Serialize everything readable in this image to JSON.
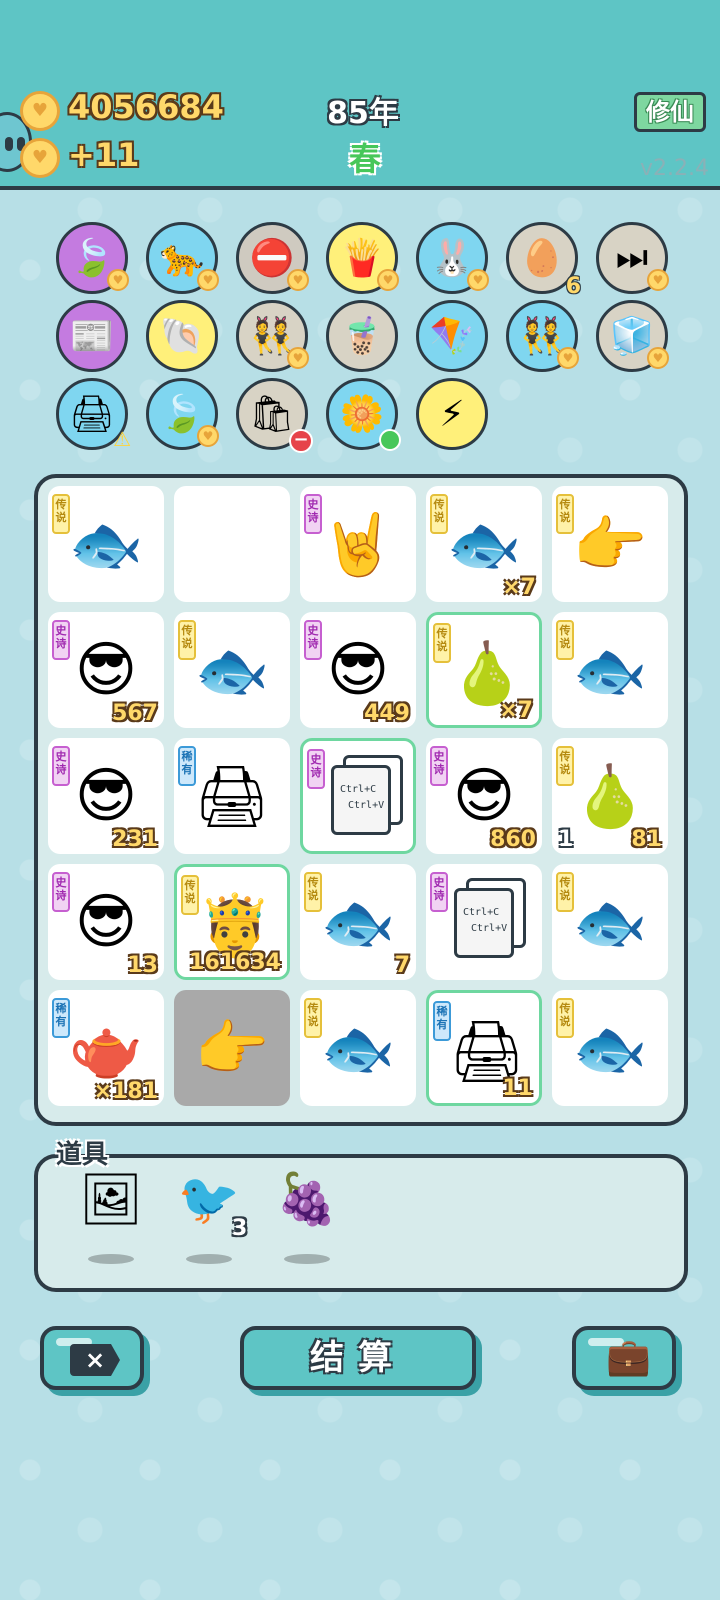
{
  "header": {
    "gold": "4056684",
    "gold_income": "+11",
    "year": "85年",
    "season": "春",
    "cultivate_button": "修仙",
    "version": "v2.2.4"
  },
  "relics": [
    {
      "icon": "🍃",
      "bg": "#c47be0",
      "badge": "heart"
    },
    {
      "icon": "🐆",
      "bg": "#7fd6f0",
      "badge": "heart"
    },
    {
      "icon": "⛔",
      "bg": "#cfcac0",
      "badge": "heart"
    },
    {
      "icon": "🍟",
      "bg": "#fff07a",
      "badge": "heart"
    },
    {
      "icon": "🐰",
      "bg": "#7fd6f0",
      "badge": "heart"
    },
    {
      "icon": "🥚",
      "bg": "#d8d3c5",
      "count": "6"
    },
    {
      "icon": "⏭",
      "bg": "#d8d3c5",
      "badge": "heart"
    },
    {
      "icon": "📰",
      "bg": "#c47be0",
      "badge": ""
    },
    {
      "icon": "🐚",
      "bg": "#fff07a",
      "badge": ""
    },
    {
      "icon": "👯",
      "bg": "#d8d3c5",
      "badge": "heart"
    },
    {
      "icon": "🧋",
      "bg": "#d8d3c5",
      "badge": ""
    },
    {
      "icon": "🪁",
      "bg": "#7fd6f0",
      "badge": ""
    },
    {
      "icon": "👯",
      "bg": "#7fd6f0",
      "badge": "heart"
    },
    {
      "icon": "🧊",
      "bg": "#d8d3c5",
      "badge": "heart"
    },
    {
      "icon": "🖨",
      "bg": "#7fd6f0",
      "badge": "warn"
    },
    {
      "icon": "🍃",
      "bg": "#7fd6f0",
      "badge": "heart"
    },
    {
      "icon": "🛍",
      "bg": "#d8d3c5",
      "badge": "minus"
    },
    {
      "icon": "🌼",
      "bg": "#7fd6f0",
      "badge": "dot"
    },
    {
      "icon": "⚡",
      "bg": "#fff07a",
      "badge": ""
    }
  ],
  "tags": {
    "legend": "传说",
    "epic": "史诗",
    "rare": "稀有"
  },
  "board": [
    {
      "tag": "legend",
      "icon": "🐟",
      "count": ""
    },
    {
      "tag": "",
      "icon": "",
      "count": ""
    },
    {
      "tag": "epic",
      "icon": "🤘",
      "count": ""
    },
    {
      "tag": "legend",
      "icon": "🐟",
      "count": "×7"
    },
    {
      "tag": "legend",
      "icon": "👉",
      "count": ""
    },
    {
      "tag": "epic",
      "icon": "😎",
      "count": "567"
    },
    {
      "tag": "legend",
      "icon": "🐟",
      "count": ""
    },
    {
      "tag": "epic",
      "icon": "😎",
      "count": "449"
    },
    {
      "tag": "legend",
      "icon": "🍐",
      "count": "×7",
      "hl": true
    },
    {
      "tag": "legend",
      "icon": "🐟",
      "count": ""
    },
    {
      "tag": "epic",
      "icon": "😎",
      "count": "231"
    },
    {
      "tag": "rare",
      "icon": "🖨",
      "count": ""
    },
    {
      "tag": "epic",
      "icon": "ctrl",
      "count": "",
      "hl": true
    },
    {
      "tag": "epic",
      "icon": "😎",
      "count": "860"
    },
    {
      "tag": "legend",
      "icon": "🍐",
      "count": "81",
      "left": "1"
    },
    {
      "tag": "epic",
      "icon": "😎",
      "count": "13"
    },
    {
      "tag": "legend",
      "icon": "🤴",
      "count": "161634",
      "hl": true
    },
    {
      "tag": "legend",
      "icon": "🐟",
      "count": "7"
    },
    {
      "tag": "epic",
      "icon": "ctrl",
      "count": ""
    },
    {
      "tag": "legend",
      "icon": "🐟",
      "count": ""
    },
    {
      "tag": "rare",
      "icon": "🫖",
      "count": "×181"
    },
    {
      "tag": "",
      "icon": "👉",
      "count": "",
      "gray": true
    },
    {
      "tag": "legend",
      "icon": "🐟",
      "count": ""
    },
    {
      "tag": "rare",
      "icon": "🖨",
      "count": "11",
      "hl": true
    },
    {
      "tag": "legend",
      "icon": "🐟",
      "count": ""
    }
  ],
  "ctrl_text": {
    "line1": "Ctrl+C",
    "line2": "Ctrl+V"
  },
  "items_label": "道具",
  "items": [
    {
      "icon": "🖼",
      "count": ""
    },
    {
      "icon": "🐦",
      "count": "3"
    },
    {
      "icon": "🍇",
      "count": ""
    }
  ],
  "buttons": {
    "exit_icon": "×",
    "settle_label": "结算",
    "bag_icon": "💼"
  },
  "colors": {
    "accent": "#5ec5c5",
    "outline": "#2d3b45",
    "gold": "#ffd86a"
  }
}
